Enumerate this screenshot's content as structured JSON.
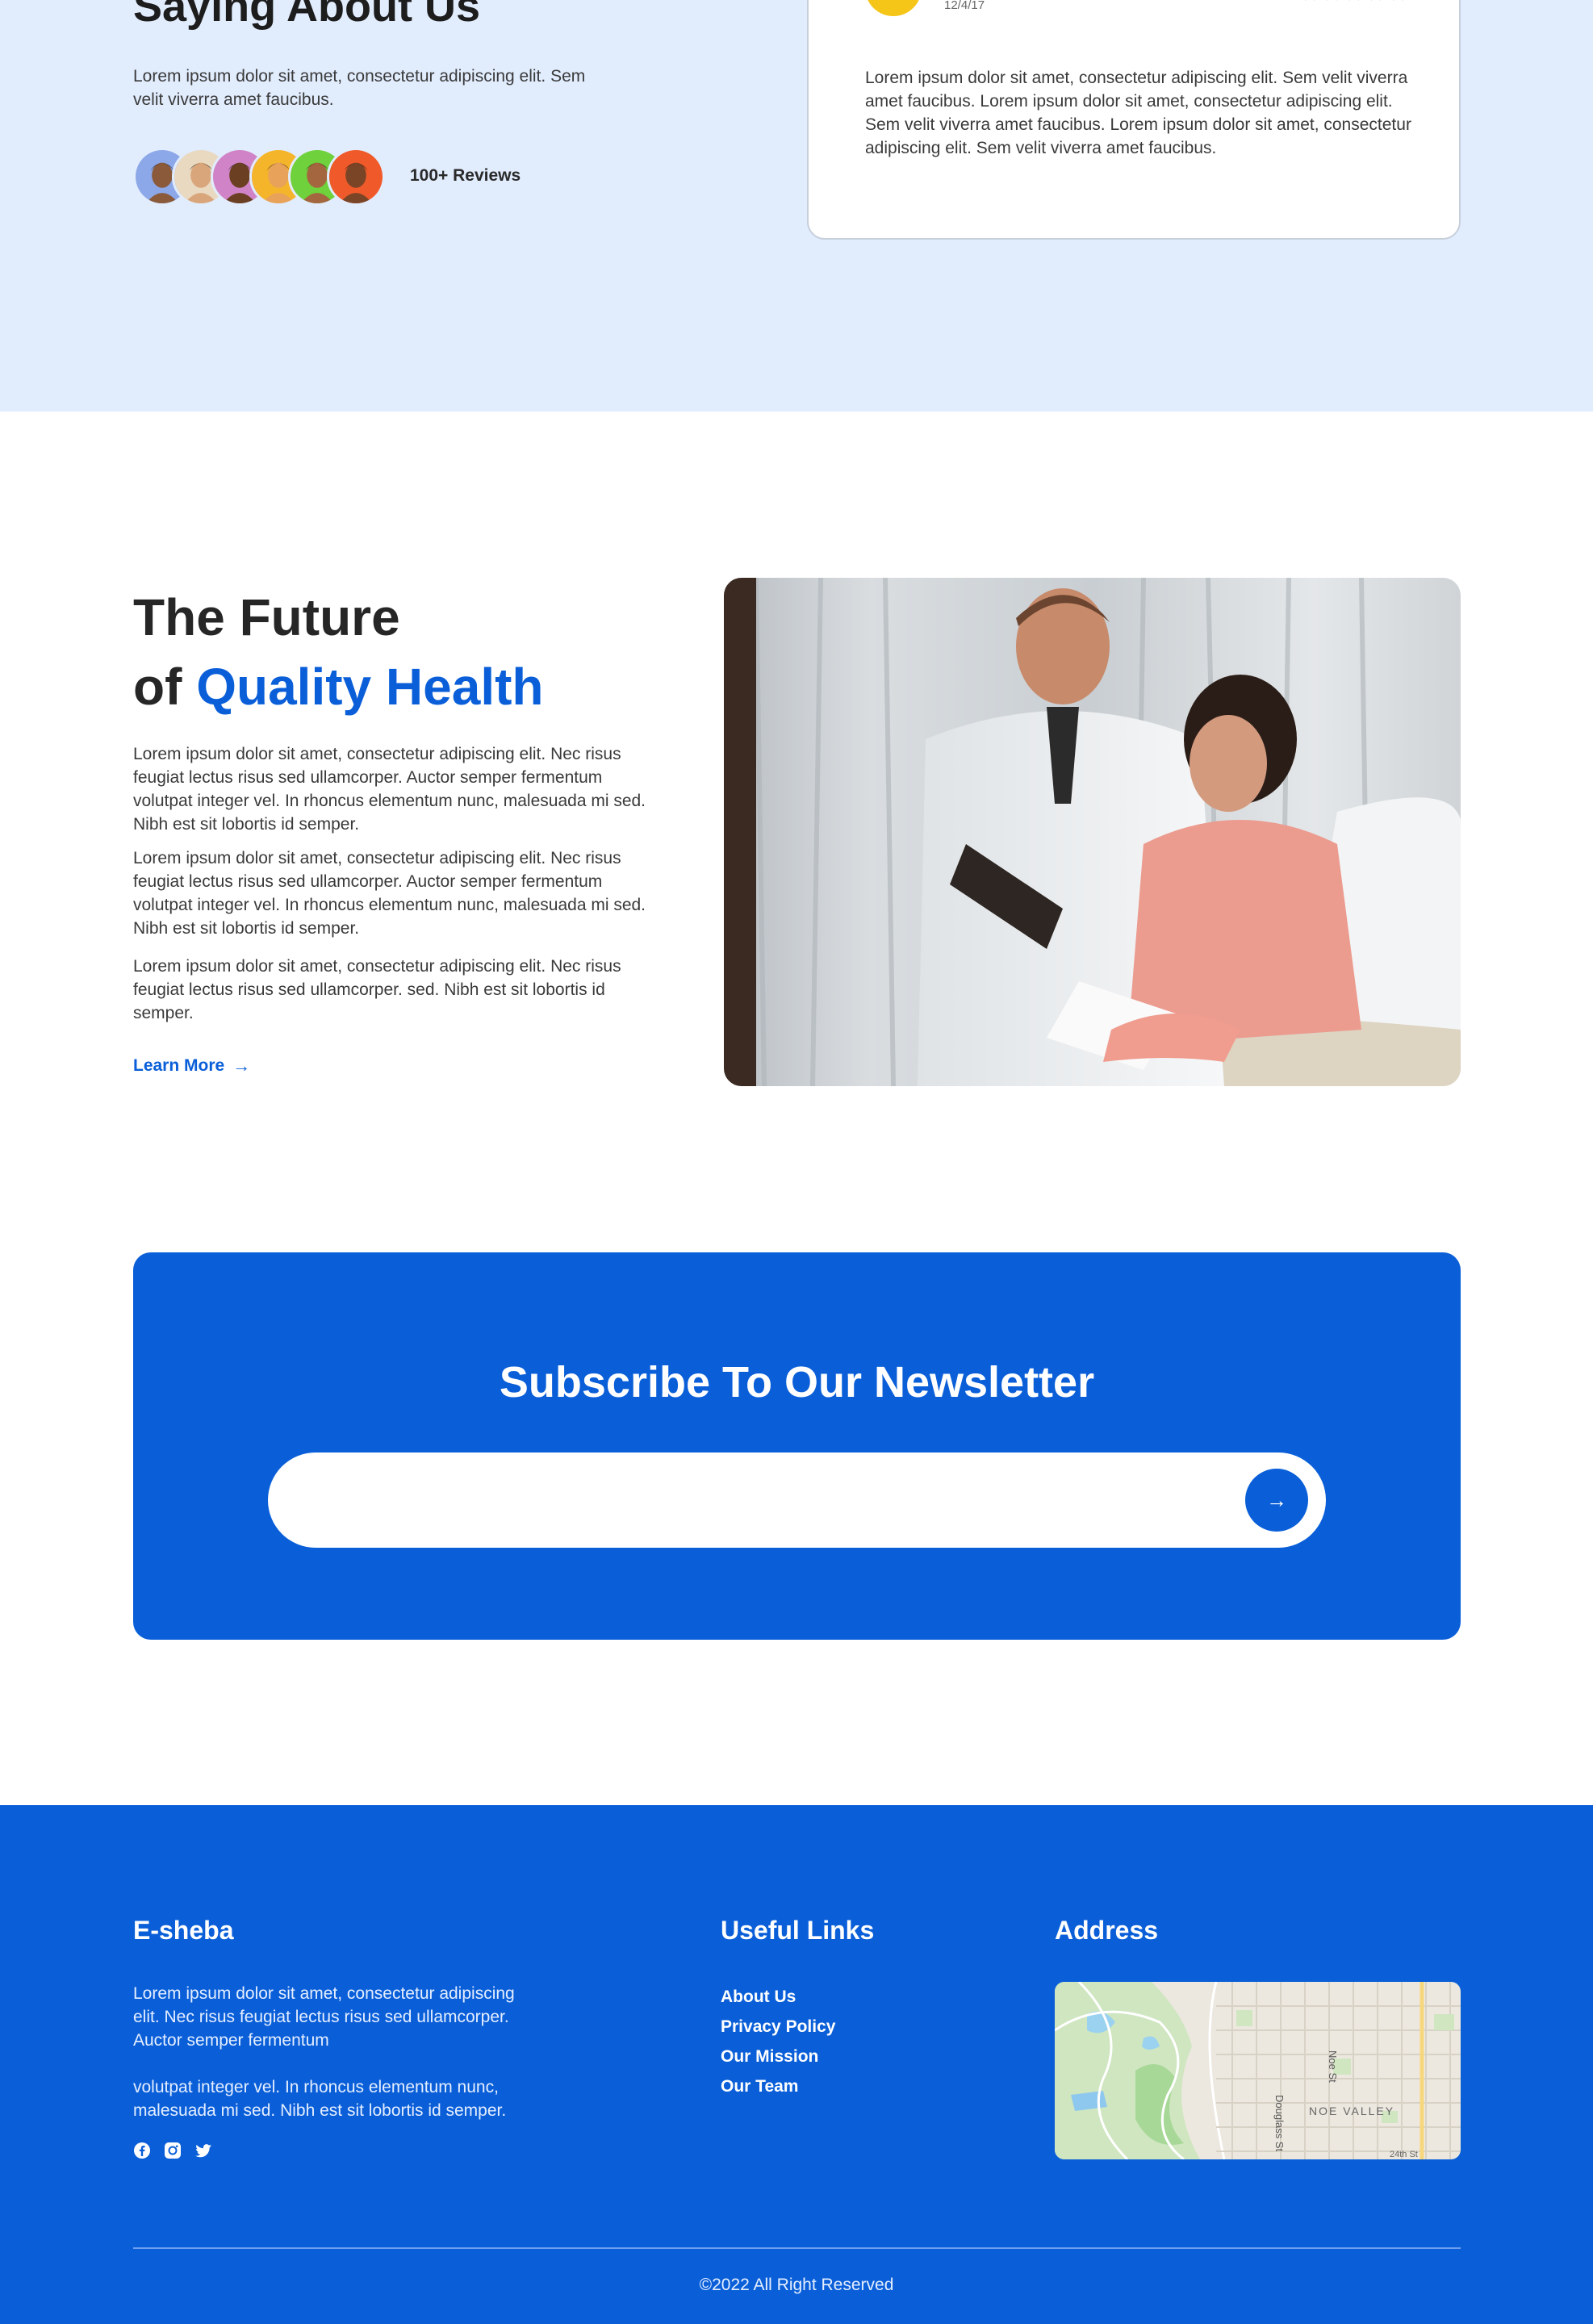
{
  "reviews": {
    "title": "Saying About Us",
    "description": "Lorem ipsum dolor sit amet, consectetur adipiscing elit. Sem velit viverra amet faucibus.",
    "count_label": "100+ Reviews",
    "avatars": [
      {
        "bg": "#8da8e8",
        "skin": "#8a5a3b",
        "hair": "#1a1a1a"
      },
      {
        "bg": "#e9d9c0",
        "skin": "#d9a57a",
        "hair": "#3b2a1c"
      },
      {
        "bg": "#d084c7",
        "skin": "#6b3f22",
        "hair": "#141414"
      },
      {
        "bg": "#f5b52b",
        "skin": "#e8a25a",
        "hair": "#3a2614"
      },
      {
        "bg": "#6fd13b",
        "skin": "#a4663e",
        "hair": "#2a1810"
      },
      {
        "bg": "#f05a2a",
        "skin": "#7a4526",
        "hair": "#1e120a"
      }
    ],
    "card": {
      "date": "12/4/17",
      "stars": "★★★★★",
      "text": "Lorem ipsum dolor sit amet, consectetur adipiscing elit. Sem velit viverra amet faucibus. Lorem ipsum dolor sit amet, consectetur adipiscing elit. Sem velit viverra amet faucibus. Lorem ipsum dolor sit amet, consectetur adipiscing elit. Sem velit viverra amet faucibus."
    }
  },
  "future": {
    "title_line1": "The Future",
    "title_of": "of",
    "title_accent": "Quality Health",
    "paragraphs": [
      "Lorem ipsum dolor sit amet, consectetur adipiscing elit. Nec risus feugiat lectus risus sed ullamcorper. Auctor semper fermentum volutpat integer vel. In rhoncus elementum nunc, malesuada mi sed. Nibh est sit lobortis id semper.",
      "Lorem ipsum dolor sit amet, consectetur adipiscing elit. Nec risus feugiat lectus risus sed ullamcorper. Auctor semper fermentum volutpat integer vel. In rhoncus elementum nunc, malesuada mi sed. Nibh est sit lobortis id semper.",
      "Lorem ipsum dolor sit amet, consectetur adipiscing elit. Nec risus feugiat lectus risus sed ullamcorper. sed. Nibh est sit lobortis id semper."
    ],
    "learn_more": "Learn More",
    "learn_more_arrow": "→"
  },
  "newsletter": {
    "title": "Subscribe To Our Newsletter",
    "input_value": "",
    "input_placeholder": "",
    "submit_icon": "→"
  },
  "footer": {
    "brand": "E-sheba",
    "description_1": "Lorem ipsum dolor sit amet, consectetur adipiscing elit. Nec risus feugiat lectus risus sed ullamcorper. Auctor semper fermentum",
    "description_2": "volutpat integer vel. In rhoncus elementum nunc, malesuada mi sed. Nibh est sit lobortis id semper.",
    "social_icons": [
      "facebook-icon",
      "instagram-icon",
      "twitter-icon"
    ],
    "useful_links_title": "Useful Links",
    "links": [
      "About Us",
      "Privacy Policy",
      "Our Mission",
      "Our Team"
    ],
    "address_title": "Address",
    "map_labels": {
      "street_1": "Noe St",
      "street_2": "Douglass St",
      "area": "NOE VALLEY",
      "street_3": "24th St"
    },
    "copyright": "©2022 All Right Reserved"
  },
  "colors": {
    "accent": "#0a5fd9",
    "reviews_bg": "#e1ecfd"
  }
}
